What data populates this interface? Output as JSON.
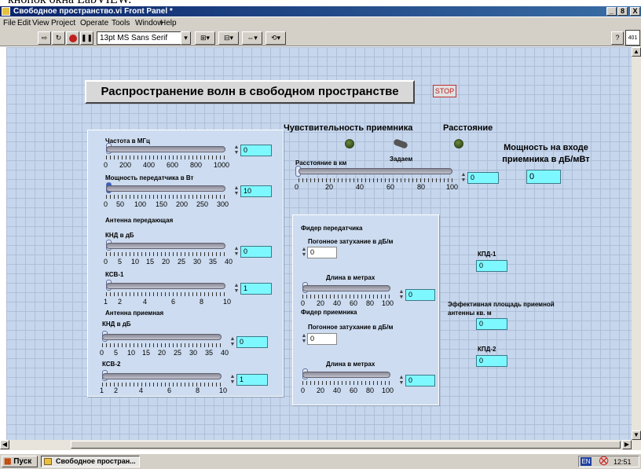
{
  "top_fragment": "кнопок окна LabVIEW.",
  "window": {
    "title": "Свободное пространство.vi Front Panel *",
    "btn_min": "_",
    "btn_max": "8",
    "btn_close": "X"
  },
  "menu": [
    "File",
    "Edit",
    "View",
    "Project",
    "Operate",
    "Tools",
    "Window",
    "Help"
  ],
  "toolbar": {
    "font": "13pt MS Sans Serif",
    "help": "?",
    "context": "401"
  },
  "panel": {
    "title": "Распространение волн в свободном пространстве",
    "stop": "STOP",
    "sens_label": "Чувствительность приемника",
    "dist_led_label": "Расстояние",
    "zadaem": "Задаем",
    "power_in_label": "Мощность на входе приемника в дБ/мВт",
    "power_in_value": "0",
    "dist_slider": {
      "label": "Расстояние в км",
      "ticks": [
        "0",
        "20",
        "40",
        "60",
        "80",
        "100"
      ],
      "value": "0"
    },
    "left": {
      "freq": {
        "label": "Частота в МГц",
        "ticks": [
          "0",
          "200",
          "400",
          "600",
          "800",
          "1000"
        ],
        "value": "0"
      },
      "tx_power": {
        "label": "Мощность передатчика в Вт",
        "ticks": [
          "0",
          "50",
          "100",
          "150",
          "200",
          "250",
          "300"
        ],
        "value": "10"
      },
      "tx_antenna": "Антенна передающая",
      "knd_tx": {
        "label": "КНД в дБ",
        "ticks": [
          "0",
          "5",
          "10",
          "15",
          "20",
          "25",
          "30",
          "35",
          "40"
        ],
        "value": "0"
      },
      "ksv1": {
        "label": "КСВ-1",
        "ticks": [
          "1",
          "2",
          "4",
          "6",
          "8",
          "10"
        ],
        "value": "1"
      },
      "rx_antenna": "Антенна приемная",
      "knd_rx": {
        "label": "КНД в дБ",
        "ticks": [
          "0",
          "5",
          "10",
          "15",
          "20",
          "25",
          "30",
          "35",
          "40"
        ],
        "value": "0"
      },
      "ksv2": {
        "label": "КСВ-2",
        "ticks": [
          "1",
          "2",
          "4",
          "6",
          "8",
          "10"
        ],
        "value": "1"
      }
    },
    "mid": {
      "tx_feeder": "Фидер передатчика",
      "tx_att_label": "Погонное затухание в дБ/м",
      "tx_att_value": "0",
      "tx_len": {
        "label": "Длина в метрах",
        "ticks": [
          "0",
          "20",
          "40",
          "60",
          "80",
          "100"
        ],
        "value": "0"
      },
      "rx_feeder": "Фидер приемника",
      "rx_att_label": "Погонное затухание в дБ/м",
      "rx_att_value": "0",
      "rx_len": {
        "label": "Длина в метрах",
        "ticks": [
          "0",
          "20",
          "40",
          "60",
          "80",
          "100"
        ],
        "value": "0"
      }
    },
    "right": {
      "kpd1_label": "КПД-1",
      "kpd1_value": "0",
      "area_label": "Эффективная площадь приемной антенны кв. м",
      "area_value": "0",
      "kpd2_label": "КПД-2",
      "kpd2_value": "0"
    }
  },
  "taskbar": {
    "start": "Пуск",
    "task": "Свободное простран...",
    "lang": "EN",
    "clock": "12:51"
  }
}
